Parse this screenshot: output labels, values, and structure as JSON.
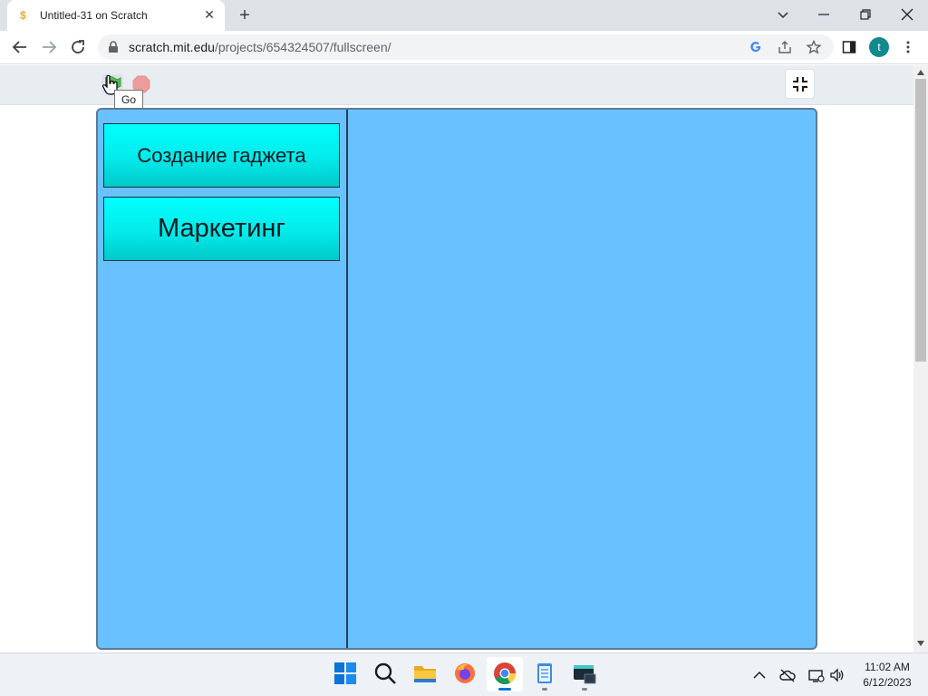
{
  "browser": {
    "tab": {
      "title": "Untitled-31 on Scratch",
      "favicon": "scratch-cat-icon"
    },
    "url_host": "scratch.mit.edu",
    "url_path": "/projects/654324507/fullscreen/",
    "profile_initial": "t"
  },
  "player": {
    "green_flag_tooltip": "Go",
    "controls": [
      "green-flag-icon",
      "stop-sign-icon",
      "exit-fullscreen-icon"
    ]
  },
  "stage": {
    "background_color": "#69c1ff",
    "buttons": [
      {
        "label": "Создание гаджета",
        "color": "#00ffff"
      },
      {
        "label": "Маркетинг",
        "color": "#00ffff"
      }
    ]
  },
  "taskbar": {
    "apps": [
      "windows-start-icon",
      "search-icon",
      "file-explorer-icon",
      "firefox-icon",
      "chrome-icon",
      "notepad-icon",
      "terminal-icon"
    ],
    "time": "11:02 AM",
    "date": "6/12/2023"
  }
}
